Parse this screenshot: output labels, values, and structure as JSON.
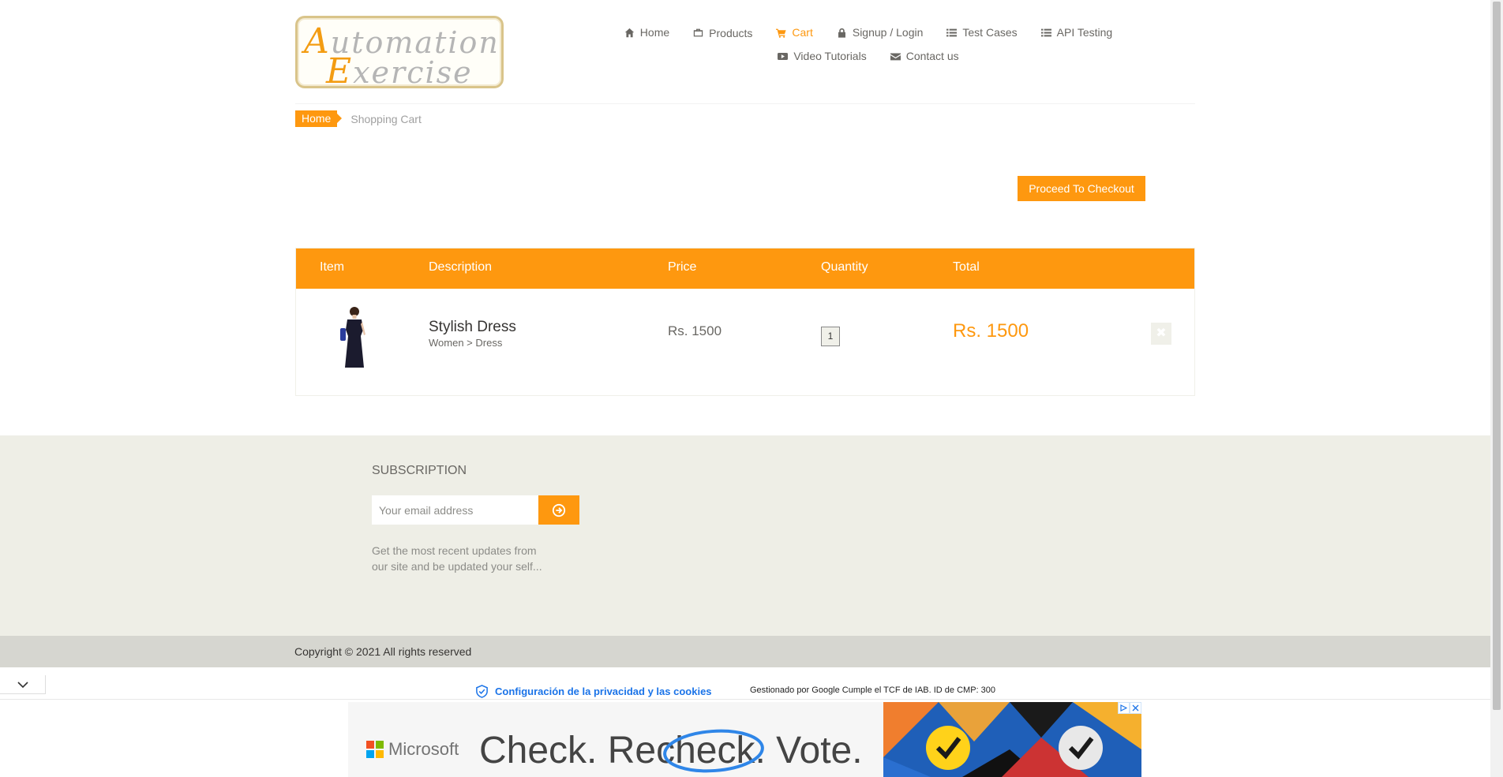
{
  "header": {
    "logo_line1": "Automation",
    "logo_line2": "Exercise",
    "nav": [
      {
        "label": "Home",
        "icon": "home-icon"
      },
      {
        "label": "Products",
        "icon": "products-icon"
      },
      {
        "label": "Cart",
        "icon": "cart-icon",
        "active": true
      },
      {
        "label": "Signup / Login",
        "icon": "lock-icon"
      },
      {
        "label": "Test Cases",
        "icon": "list-icon"
      },
      {
        "label": "API Testing",
        "icon": "list-icon"
      },
      {
        "label": "Video Tutorials",
        "icon": "youtube-icon"
      },
      {
        "label": "Contact us",
        "icon": "envelope-icon"
      }
    ]
  },
  "breadcrumb": {
    "home": "Home",
    "current": "Shopping Cart"
  },
  "checkout_button": "Proceed To Checkout",
  "cart": {
    "headers": [
      "Item",
      "Description",
      "Price",
      "Quantity",
      "Total"
    ],
    "rows": [
      {
        "name": "Stylish Dress",
        "category": "Women > Dress",
        "price": "Rs. 1500",
        "quantity": "1",
        "total": "Rs. 1500"
      }
    ]
  },
  "subscription": {
    "title": "SUBSCRIPTION",
    "placeholder": "Your email address",
    "text": "Get the most recent updates from our site and be updated your self..."
  },
  "footer": {
    "copyright": "Copyright © 2021 All rights reserved"
  },
  "privacy": {
    "link": "Configuración de la privacidad y las cookies",
    "note": "Gestionado por Google Cumple el TCF de IAB. ID de CMP: 300"
  },
  "ad": {
    "brand": "Microsoft",
    "headline": "Check. Recheck. Vote."
  },
  "colors": {
    "accent": "#FE980F",
    "footer_bg": "#eeeee6",
    "footer_bottom_bg": "#d6d6d0"
  }
}
